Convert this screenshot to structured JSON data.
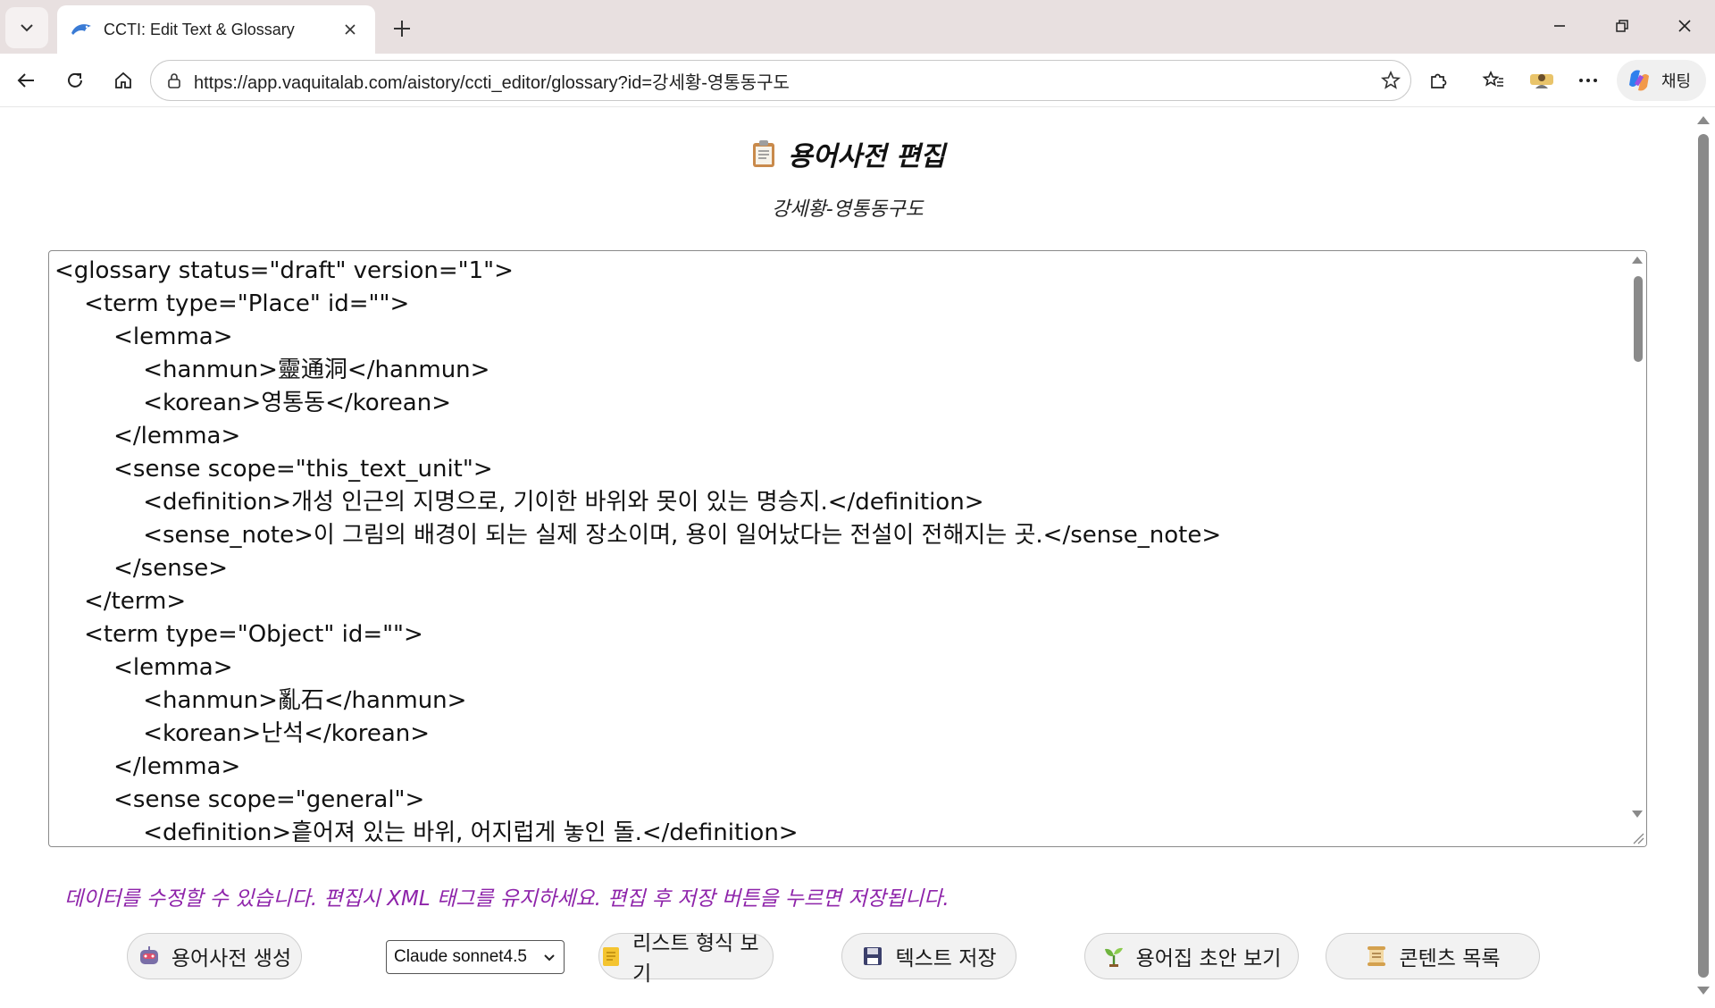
{
  "browser": {
    "tab_title": "CCTI: Edit Text & Glossary",
    "url": "https://app.vaquitalab.com/aistory/ccti_editor/glossary?id=강세황-영통동구도",
    "copilot_label": "채팅",
    "icons": {
      "tab_menu": "chevron-down-icon",
      "favicon": "dolphin-icon",
      "tab_close": "close-icon",
      "new_tab": "plus-icon",
      "minimize": "minimize-icon",
      "restore": "restore-icon",
      "close_window": "close-icon",
      "back": "back-arrow-icon",
      "refresh": "refresh-icon",
      "home": "home-icon",
      "site_info": "lock-icon",
      "favorite": "star-icon",
      "extensions": "puzzle-icon",
      "favorites": "favorites-icon",
      "profile": "avatar-icon",
      "more": "more-icon",
      "copilot": "copilot-icon"
    }
  },
  "page": {
    "title": "용어사전 편집",
    "subtitle": "강세황-영통동구도",
    "editor_content": "<glossary status=\"draft\" version=\"1\">\n\t<term type=\"Place\" id=\"\">\n\t\t<lemma>\n\t\t\t<hanmun>靈通洞</hanmun>\n\t\t\t<korean>영통동</korean>\n\t\t</lemma>\n\t\t<sense scope=\"this_text_unit\">\n\t\t\t<definition>개성 인근의 지명으로, 기이한 바위와 못이 있는 명승지.</definition>\n\t\t\t<sense_note>이 그림의 배경이 되는 실제 장소이며, 용이 일어났다는 전설이 전해지는 곳.</sense_note>\n\t\t</sense>\n\t</term>\n\t<term type=\"Object\" id=\"\">\n\t\t<lemma>\n\t\t\t<hanmun>亂石</hanmun>\n\t\t\t<korean>난석</korean>\n\t\t</lemma>\n\t\t<sense scope=\"general\">\n\t\t\t<definition>흩어져 있는 바위, 어지럽게 놓인 돌.</definition>",
    "hint": "데이터를 수정할 수 있습니다. 편집시 XML 태그를 유지하세요. 편집 후 저장 버튼을 누르면 저장됩니다.",
    "buttons": {
      "generate": "용어사전 생성",
      "list_view": "리스트 형식 보기",
      "save_text": "텍스트 저장",
      "draft_view": "용어집 초안 보기",
      "contents": "콘텐츠 목록"
    },
    "model_select": {
      "selected": "Claude sonnet4.5"
    },
    "colors": {
      "hint": "#8e24aa",
      "button_bg": "#f2f2f2"
    }
  }
}
